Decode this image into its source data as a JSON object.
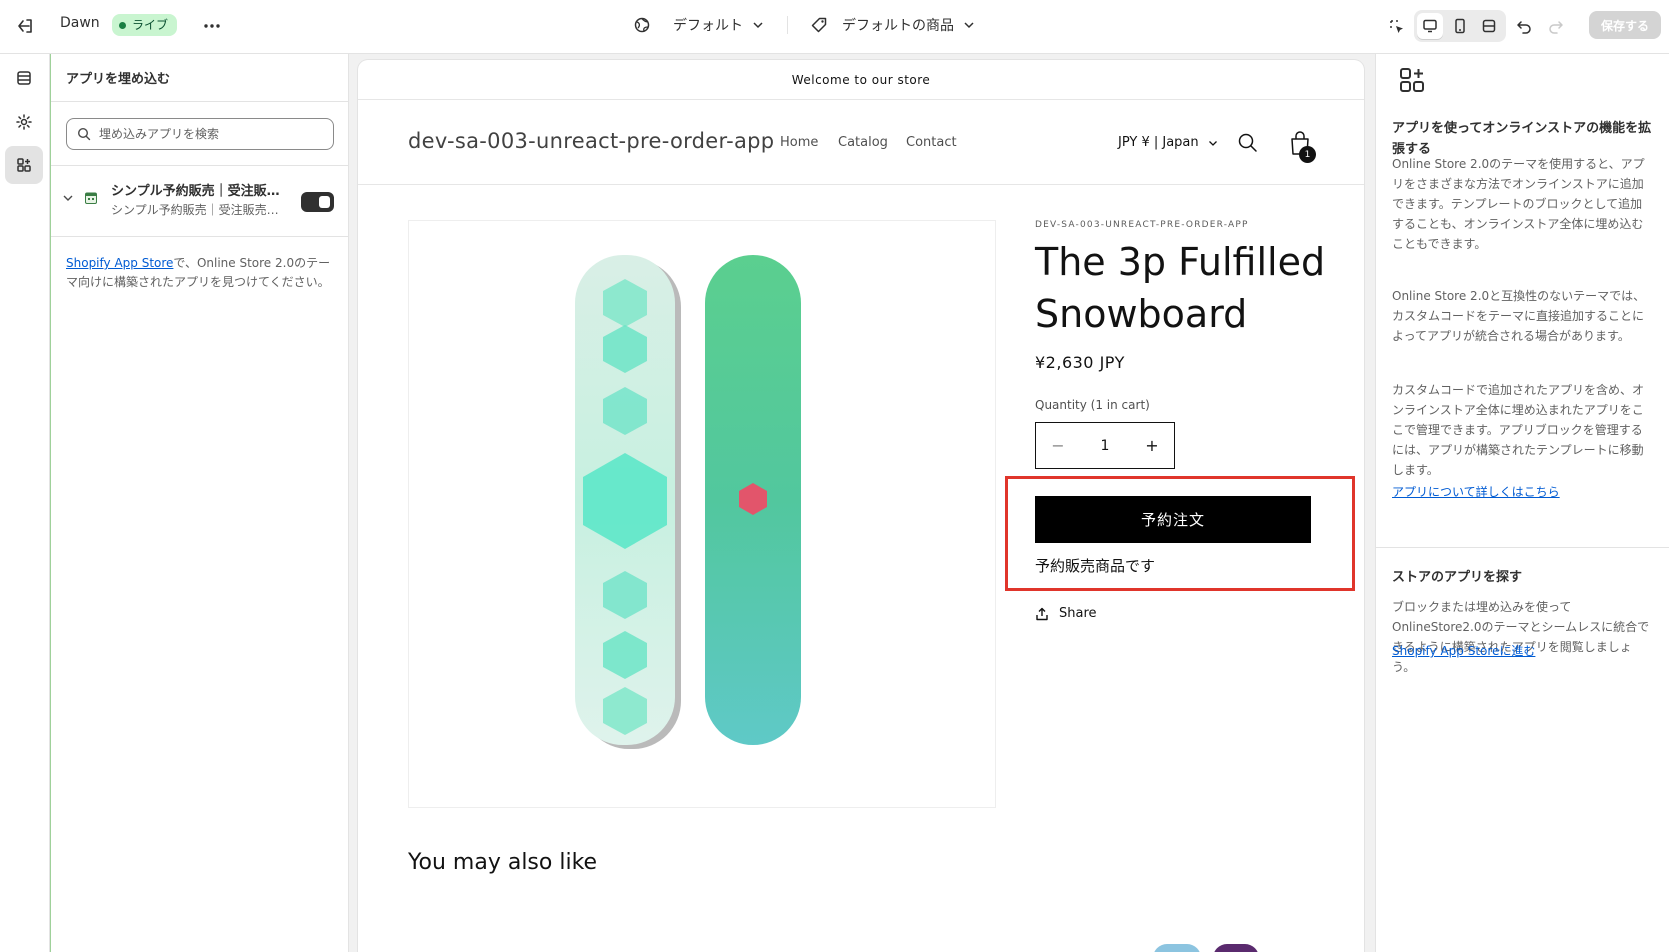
{
  "topbar": {
    "theme_name": "Dawn",
    "live_badge": "ライブ",
    "template_label": "デフォルト",
    "product_label": "デフォルトの商品",
    "save_label": "保存する"
  },
  "left_panel": {
    "title": "アプリを埋め込む",
    "search_placeholder": "埋め込みアプリを検索",
    "app": {
      "name": "シンプル予約販売｜受注販売・予約注文",
      "subtitle": "シンプル予約販売｜受注販売・予約注文",
      "enabled": true
    },
    "help_link": "Shopify App Store",
    "help_text": "で、Online Store 2.0のテーマ向けに構築されたアプリを見つけてください。"
  },
  "store": {
    "announcement": "Welcome to our store",
    "name": "dev-sa-003-unreact-pre-order-app",
    "nav": [
      "Home",
      "Catalog",
      "Contact"
    ],
    "currency": "JPY ¥ | Japan",
    "cart_count": "1"
  },
  "product": {
    "vendor": "DEV-SA-003-UNREACT-PRE-ORDER-APP",
    "title": "The 3p Fulfilled Snowboard",
    "price": "¥2,630 JPY",
    "quantity_label": "Quantity (1 in cart)",
    "quantity": "1",
    "preorder_button": "予約注文",
    "preorder_note": "予約販売商品です",
    "share_label": "Share"
  },
  "also_like": "You may also like",
  "right_panel": {
    "heading": "アプリを使ってオンラインストアの機能を拡張する",
    "p1": "Online Store 2.0のテーマを使用すると、アプリをさまざまな方法でオンラインストアに追加できます。テンプレートのブロックとして追加することも、オンラインストア全体に埋め込むこともできます。",
    "p2": "Online Store 2.0と互換性のないテーマでは、カスタムコードをテーマに直接追加することによってアプリが統合される場合があります。",
    "p3": "カスタムコードで追加されたアプリを含め、オンラインストア全体に埋め込まれたアプリをここで管理できます。アプリブロックを管理するには、アプリが構築されたテンプレートに移動します。",
    "learn_link": "アプリについて詳しくはこちら",
    "heading2": "ストアのアプリを探す",
    "p4": "ブロックまたは埋め込みを使って OnlineStore2.0のテーマとシームレスに統合できるように構築されたアプリを閲覧しましょう。",
    "store_link": "Shopify App Storeに進む"
  },
  "colors": {
    "highlight": "#e0352b",
    "live_badge_bg": "#c9f5d0",
    "link": "#005bd3"
  },
  "icons": [
    "exit-icon",
    "more-icon",
    "globe-icon",
    "tag-icon",
    "chevron-down-icon",
    "select-icon",
    "desktop-icon",
    "mobile-icon",
    "fullscreen-icon",
    "undo-icon",
    "redo-icon",
    "sections-icon",
    "gear-icon",
    "apps-icon",
    "search-icon",
    "cart-icon",
    "share-icon"
  ]
}
